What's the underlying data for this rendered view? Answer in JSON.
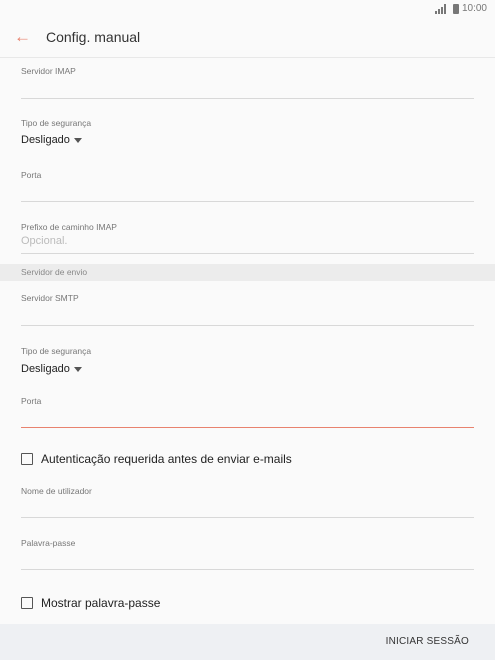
{
  "status": {
    "time": "10:00"
  },
  "header": {
    "title": "Config. manual"
  },
  "fields": {
    "imap_server": {
      "label": "Servidor IMAP"
    },
    "security_type_1": {
      "label": "Tipo de segurança",
      "value": "Desligado"
    },
    "port_1": {
      "label": "Porta"
    },
    "imap_path_prefix": {
      "label": "Prefixo de caminho IMAP",
      "placeholder": "Opcional."
    },
    "outgoing_section": {
      "label": "Servidor de envio"
    },
    "smtp_server": {
      "label": "Servidor SMTP"
    },
    "security_type_2": {
      "label": "Tipo de segurança",
      "value": "Desligado"
    },
    "port_2": {
      "label": "Porta"
    },
    "auth_checkbox": {
      "label": "Autenticação requerida antes de enviar e-mails",
      "checked": false
    },
    "username": {
      "label": "Nome de utilizador"
    },
    "password": {
      "label": "Palavra-passe"
    },
    "show_password": {
      "label": "Mostrar palavra-passe",
      "checked": false
    }
  },
  "footer": {
    "signin_label": "INICIAR SESSÃO"
  },
  "colors": {
    "accent": "#e8826e",
    "background": "#fafafa",
    "section": "#ececec"
  }
}
